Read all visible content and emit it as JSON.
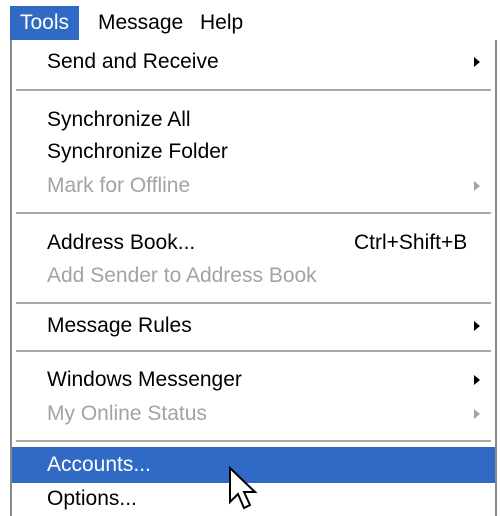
{
  "menubar": {
    "items": [
      {
        "label": "Tools"
      },
      {
        "label": "Message"
      },
      {
        "label": "Help"
      }
    ]
  },
  "tools_menu": {
    "send_and_receive": {
      "label": "Send and Receive"
    },
    "synchronize_all": {
      "label": "Synchronize All"
    },
    "synchronize_folder": {
      "label": "Synchronize Folder"
    },
    "mark_for_offline": {
      "label": "Mark for Offline"
    },
    "address_book": {
      "label": "Address Book...",
      "shortcut": "Ctrl+Shift+B"
    },
    "add_sender": {
      "label": "Add Sender to Address Book"
    },
    "message_rules": {
      "label": "Message Rules"
    },
    "windows_messenger": {
      "label": "Windows Messenger"
    },
    "my_online_status": {
      "label": "My Online Status"
    },
    "accounts": {
      "label": "Accounts..."
    },
    "options": {
      "label": "Options..."
    }
  },
  "colors": {
    "highlight": "#316ac5",
    "disabled_text": "#a3a3a3",
    "border": "#8a8a8a"
  },
  "icons": {
    "submenu": "submenu-arrow-icon",
    "pointer": "mouse-pointer-icon"
  }
}
